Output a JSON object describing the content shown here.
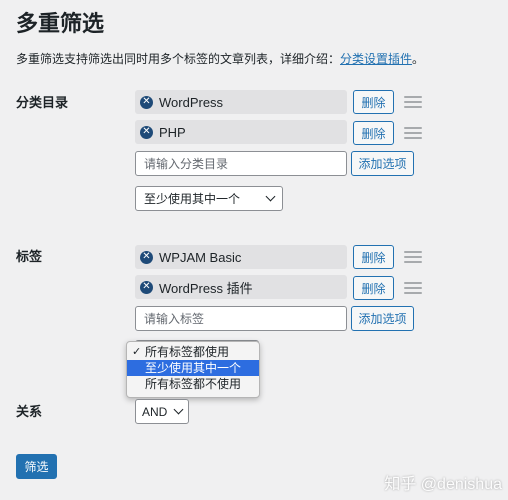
{
  "page": {
    "title": "多重筛选",
    "description": "多重筛选支持筛选出同时用多个标签的文章列表，详细介绍：",
    "description_link": "分类设置插件",
    "description_end": "。"
  },
  "category": {
    "label": "分类目录",
    "tags": [
      "WordPress",
      "PHP"
    ],
    "delete_label": "删除",
    "input_placeholder": "请输入分类目录",
    "add_label": "添加选项",
    "select_value": "至少使用其中一个"
  },
  "tag_section": {
    "label": "标签",
    "tags": [
      "WPJAM Basic",
      "WordPress 插件"
    ],
    "delete_label": "删除",
    "input_placeholder": "请输入标签",
    "add_label": "添加选项"
  },
  "dropdown": {
    "options": [
      "所有标签都使用",
      "至少使用其中一个",
      "所有标签都不使用"
    ],
    "checked_index": 0,
    "highlighted_index": 1,
    "check_mark": "✓"
  },
  "relation": {
    "label": "关系",
    "value": "AND"
  },
  "submit_label": "筛选",
  "watermark": "知乎 @denishua",
  "colors": {
    "accent": "#2271b1",
    "highlight": "#2d6de0",
    "tag_bg": "#e1e1e3",
    "remove_icon": "#1e4a78"
  }
}
